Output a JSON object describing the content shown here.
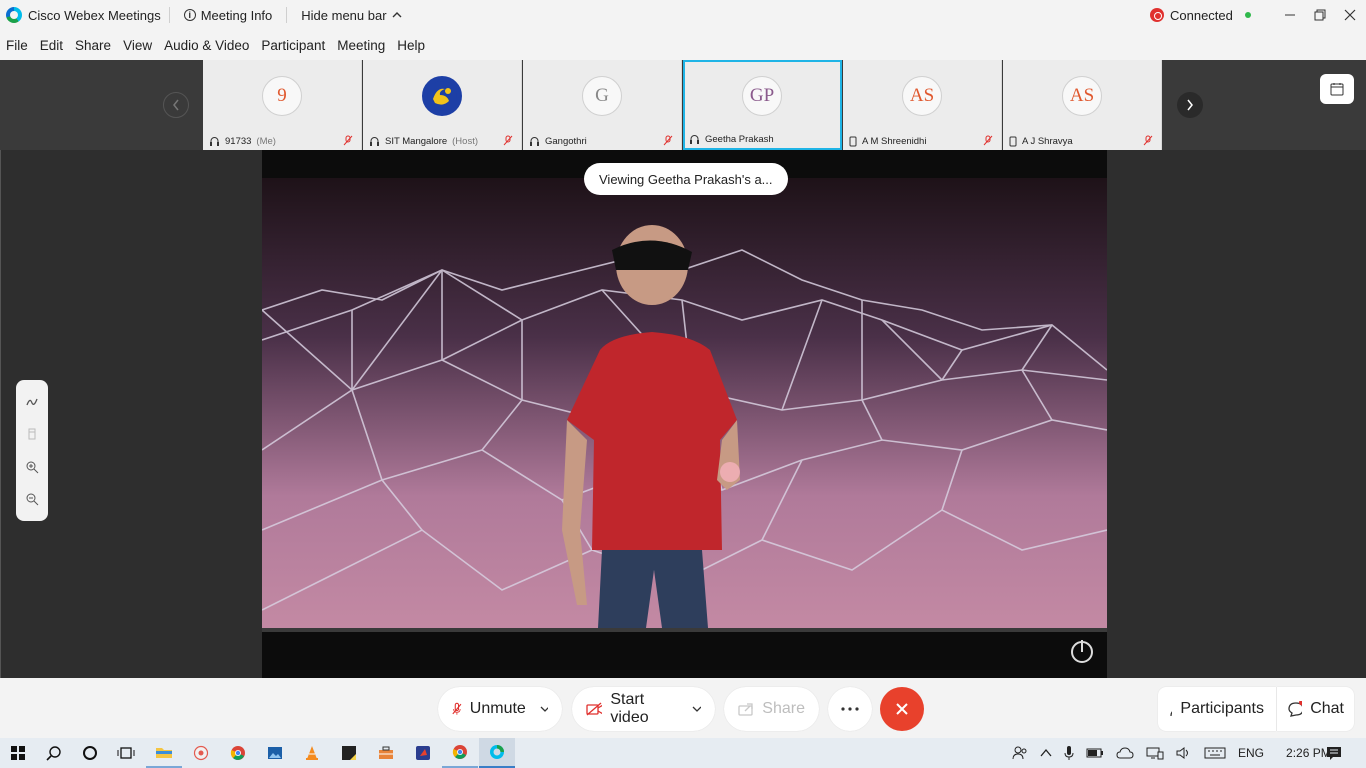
{
  "titlebar": {
    "app_title": "Cisco Webex Meetings",
    "meeting_info": "Meeting Info",
    "hide_menu": "Hide menu bar",
    "status": "Connected"
  },
  "menu": [
    "File",
    "Edit",
    "Share",
    "View",
    "Audio & Video",
    "Participant",
    "Meeting",
    "Help"
  ],
  "participants": [
    {
      "initials": "9",
      "name": "91733",
      "role": "(Me)",
      "color": "#e0582e",
      "device": "headset-icon",
      "muted": true
    },
    {
      "initials": "",
      "name": "SIT Mangalore",
      "role": "(Host)",
      "color": "#1d3fa6",
      "device": "headset-icon",
      "muted": true
    },
    {
      "initials": "G",
      "name": "Gangothri",
      "role": "",
      "color": "#888888",
      "device": "headset-icon",
      "muted": true
    },
    {
      "initials": "GP",
      "name": "Geetha Prakash",
      "role": "",
      "color": "#8a5a8c",
      "device": "headset-icon",
      "muted": false
    },
    {
      "initials": "AS",
      "name": "A M Shreenidhi",
      "role": "",
      "color": "#e0582e",
      "device": "phone-icon",
      "muted": true
    },
    {
      "initials": "AS",
      "name": "A J Shravya",
      "role": "",
      "color": "#e0582e",
      "device": "phone-icon",
      "muted": true
    }
  ],
  "stage": {
    "viewing_label": "Viewing Geetha Prakash's a..."
  },
  "controls": {
    "unmute": "Unmute",
    "start_video": "Start video",
    "share": "Share",
    "participants": "Participants",
    "chat": "Chat"
  },
  "tray": {
    "lang": "ENG",
    "time": "2:26 PM"
  },
  "colors": {
    "accent": "#1fb4e6",
    "end_call": "#e8412c",
    "mute_red": "#e0312e"
  }
}
